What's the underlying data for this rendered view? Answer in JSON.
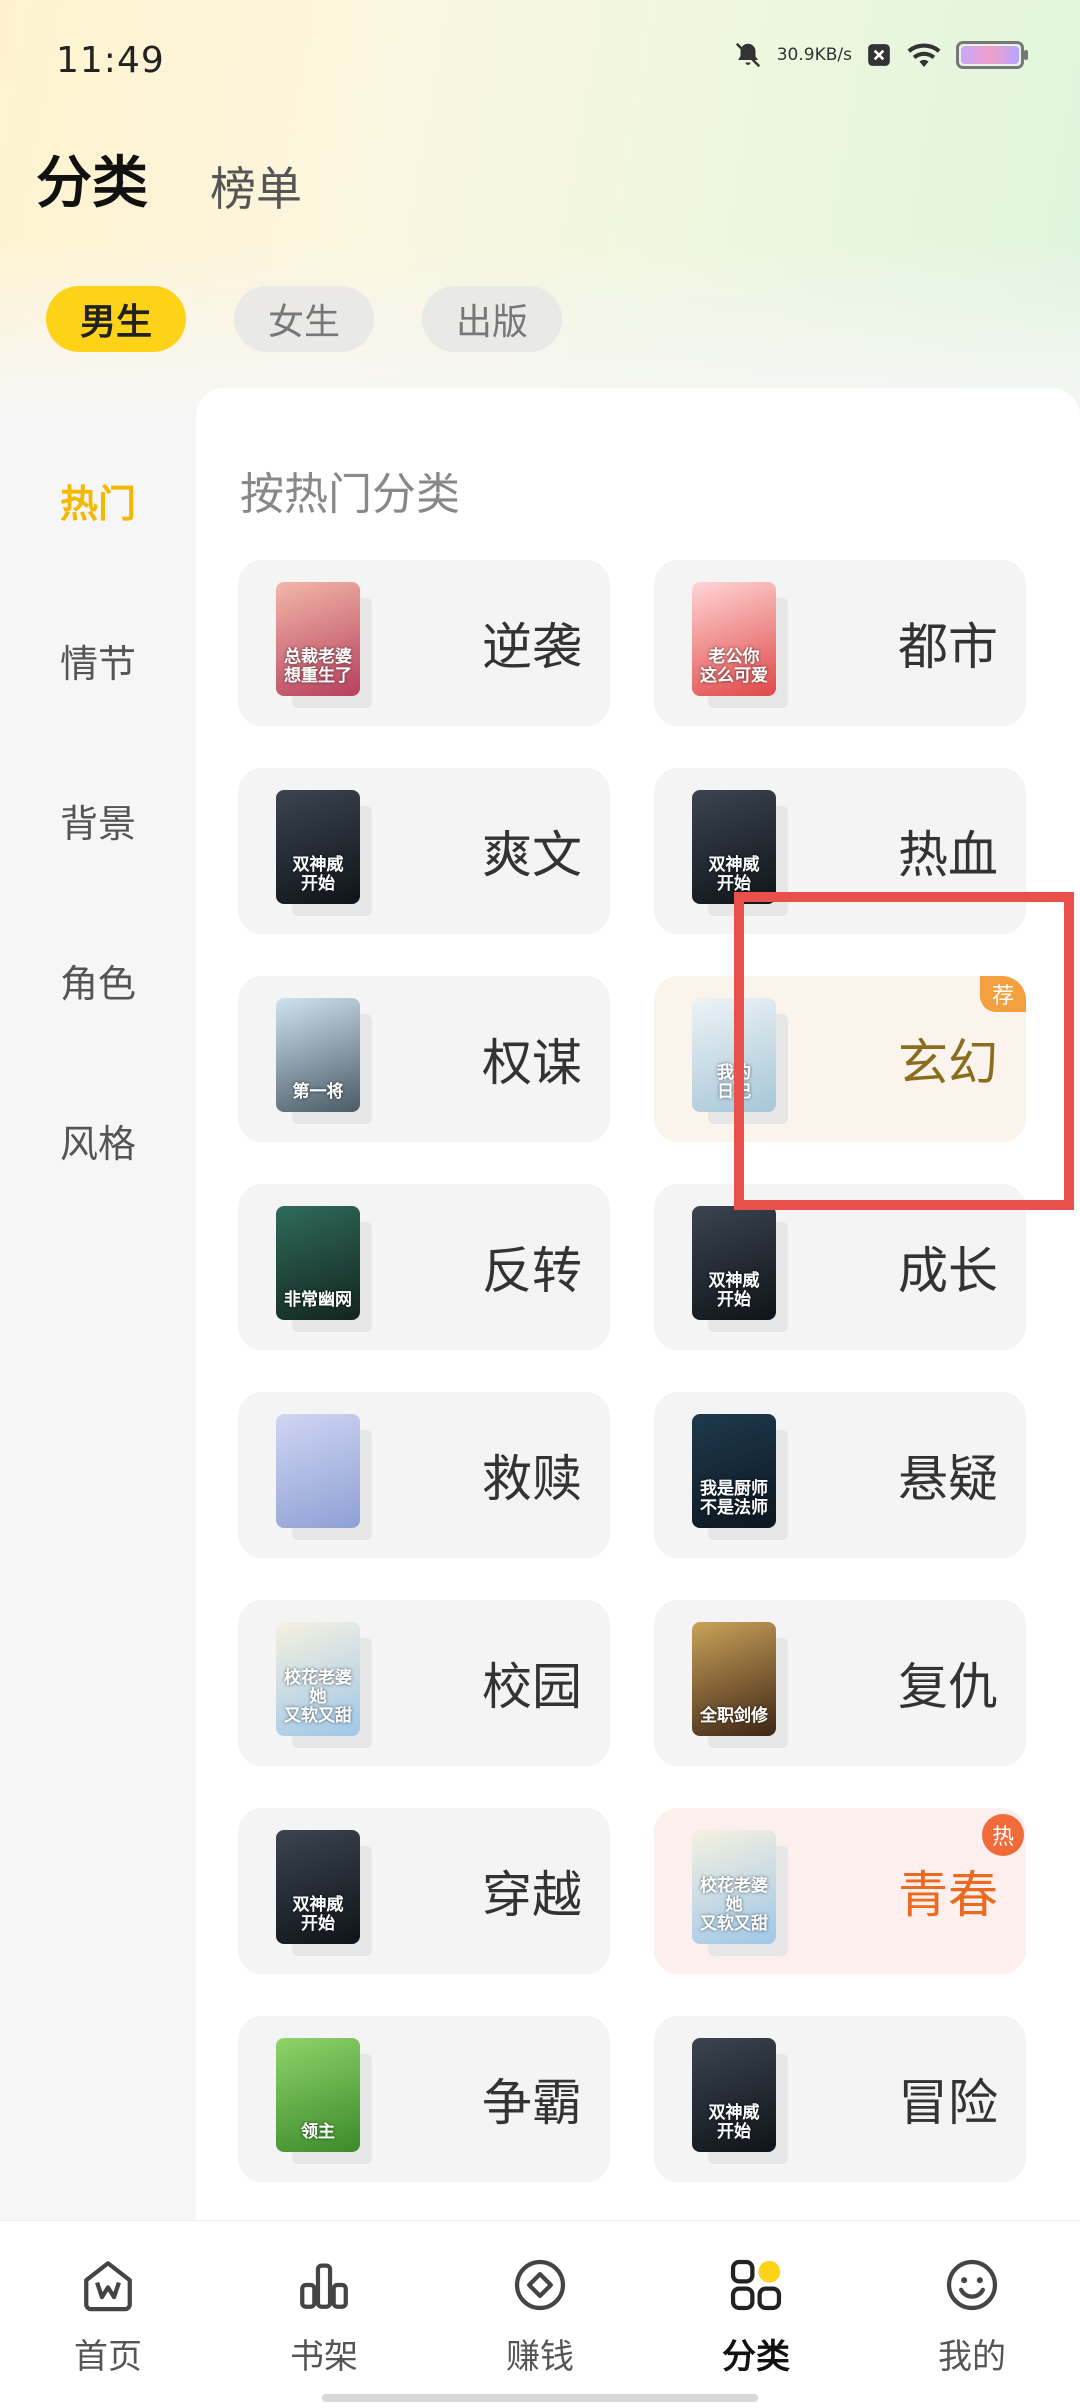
{
  "status_bar": {
    "time": "11:49",
    "net_speed_value": "30.9",
    "net_speed_unit": "KB/s",
    "icons": [
      "bell-muted-icon",
      "close-box-icon",
      "wifi-icon",
      "battery-icon"
    ]
  },
  "top_tabs": [
    {
      "label": "分类",
      "active": true
    },
    {
      "label": "榜单",
      "active": false
    }
  ],
  "gender_chips": [
    {
      "label": "男生",
      "active": true
    },
    {
      "label": "女生",
      "active": false
    },
    {
      "label": "出版",
      "active": false
    }
  ],
  "left_nav": [
    {
      "label": "热门",
      "active": true
    },
    {
      "label": "情节",
      "active": false
    },
    {
      "label": "背景",
      "active": false
    },
    {
      "label": "角色",
      "active": false
    },
    {
      "label": "风格",
      "active": false
    }
  ],
  "panel": {
    "title": "按热门分类",
    "categories": [
      {
        "label": "逆袭",
        "cover_text": "总裁老婆\n想重生了",
        "cover_colors": [
          "#f3b7a9",
          "#b6405c"
        ]
      },
      {
        "label": "都市",
        "cover_text": "老公你\n这么可爱",
        "cover_colors": [
          "#ffd5d5",
          "#e04848"
        ]
      },
      {
        "label": "爽文",
        "cover_text": "双神威\n开始",
        "cover_colors": [
          "#3b4452",
          "#101418"
        ]
      },
      {
        "label": "热血",
        "cover_text": "双神威\n开始",
        "cover_colors": [
          "#3b4452",
          "#101418"
        ]
      },
      {
        "label": "权谋",
        "cover_text": "第一将",
        "cover_colors": [
          "#cfe3ee",
          "#4a5a66"
        ]
      },
      {
        "label": "玄幻",
        "cover_text": "我的\n日记",
        "cover_colors": [
          "#eef3f6",
          "#a6c6d8"
        ],
        "badge": "荐"
      },
      {
        "label": "反转",
        "cover_text": "非常幽网",
        "cover_colors": [
          "#2f6b5a",
          "#13251f"
        ]
      },
      {
        "label": "成长",
        "cover_text": "双神威\n开始",
        "cover_colors": [
          "#3b4452",
          "#101418"
        ]
      },
      {
        "label": "救赎",
        "cover_text": "",
        "cover_colors": [
          "#cfd6f2",
          "#8fa0d6"
        ]
      },
      {
        "label": "悬疑",
        "cover_text": "我是厨师\n不是法师",
        "cover_colors": [
          "#1e3a4e",
          "#0c1620"
        ]
      },
      {
        "label": "校园",
        "cover_text": "校花老婆她\n又软又甜",
        "cover_colors": [
          "#f6f1e0",
          "#9fc7e8"
        ]
      },
      {
        "label": "复仇",
        "cover_text": "全职剑修",
        "cover_colors": [
          "#caa25a",
          "#3e2616"
        ]
      },
      {
        "label": "穿越",
        "cover_text": "双神威\n开始",
        "cover_colors": [
          "#3b4452",
          "#101418"
        ]
      },
      {
        "label": "青春",
        "cover_text": "校花老婆她\n又软又甜",
        "cover_colors": [
          "#f6f1e0",
          "#9fc7e8"
        ],
        "badge": "热"
      },
      {
        "label": "争霸",
        "cover_text": "领主",
        "cover_colors": [
          "#8fd46a",
          "#3b8a2a"
        ]
      },
      {
        "label": "冒险",
        "cover_text": "双神威\n开始",
        "cover_colors": [
          "#3b4452",
          "#101418"
        ]
      }
    ]
  },
  "bottom_nav": [
    {
      "label": "首页",
      "icon": "home-icon",
      "active": false
    },
    {
      "label": "书架",
      "icon": "bookshelf-icon",
      "active": false
    },
    {
      "label": "赚钱",
      "icon": "earn-coin-icon",
      "active": false
    },
    {
      "label": "分类",
      "icon": "category-grid-icon",
      "active": true
    },
    {
      "label": "我的",
      "icon": "profile-smile-icon",
      "active": false
    }
  ]
}
